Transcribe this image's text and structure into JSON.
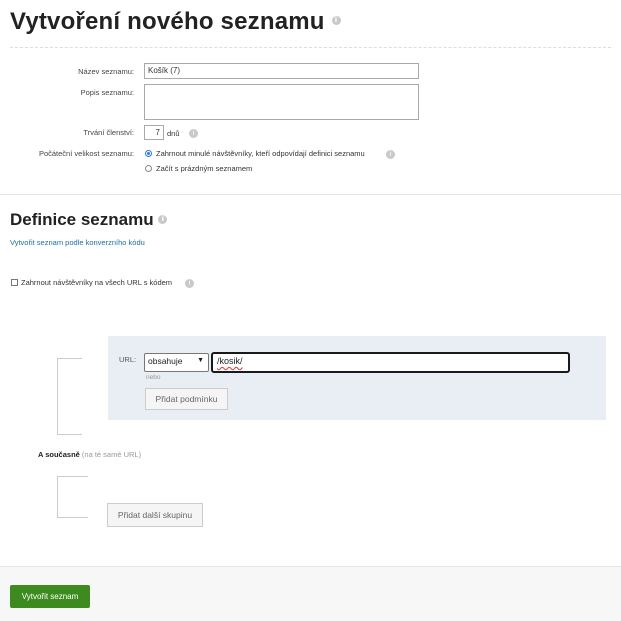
{
  "page": {
    "title": "Vytvoření nového seznamu"
  },
  "form": {
    "name_label": "Název seznamu:",
    "name_value": "Košík (7)",
    "desc_label": "Popis seznamu:",
    "desc_value": "",
    "duration_label": "Trvání členství:",
    "duration_value": "7",
    "duration_unit": "dnů",
    "initial_size_label": "Počáteční velikost seznamu:",
    "radio_options": [
      {
        "label": "Zahrnout minulé návštěvníky, kteří odpovídají definici seznamu",
        "checked": true
      },
      {
        "label": "Začít s prázdným seznamem",
        "checked": false
      }
    ]
  },
  "definition": {
    "title": "Definice seznamu",
    "conversion_link": "Vytvořit seznam podle konverzního kódu",
    "include_all_checkbox": "Zahrnout návštěvníky na všech URL s kódem",
    "include_all_checked": false,
    "url_label": "URL:",
    "operator_value": "obsahuje",
    "url_value": "/kosik/",
    "or_text": "nebo",
    "add_condition_button": "Přidat podmínku",
    "and_label": "A současně",
    "and_hint": "(na té samé URL)",
    "add_group_button": "Přidat další skupinu"
  },
  "footer": {
    "create_button": "Vytvořit seznam"
  },
  "colors": {
    "primary_button": "#3d8b1e",
    "link": "#1a6fb5",
    "group_bg": "#e8eef3"
  }
}
